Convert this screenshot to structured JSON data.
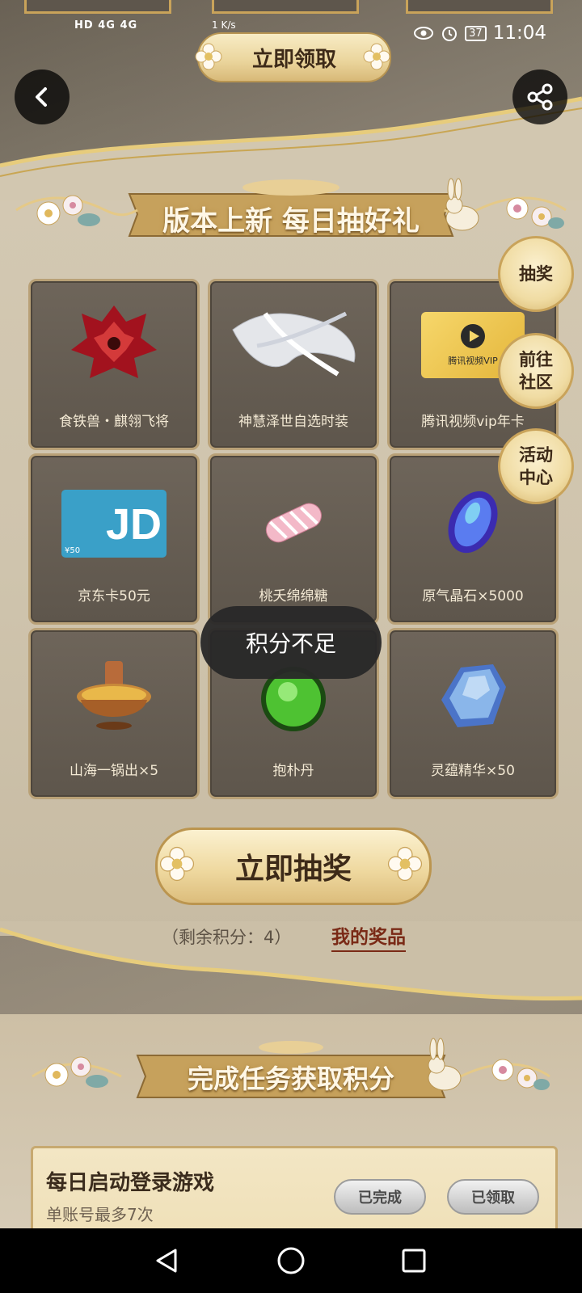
{
  "status_bar": {
    "network": "HD 4G 4G",
    "speed": "1 K/s",
    "battery": "37",
    "time": "11:04"
  },
  "header": {
    "claim_button": "立即领取"
  },
  "draw_section": {
    "banner_title": "版本上新 每日抽好礼",
    "prizes": [
      {
        "name": "食铁兽・麒翎飞将"
      },
      {
        "name": "神慧泽世自选时装"
      },
      {
        "name": "腾讯视频vip年卡",
        "card_text": "腾讯视频VIP"
      },
      {
        "name": "京东卡50元",
        "card_text": "JD",
        "amount": "¥50"
      },
      {
        "name": "桃夭绵绵糖"
      },
      {
        "name": "原气晶石×5000"
      },
      {
        "name": "山海一锅出×5"
      },
      {
        "name": "抱朴丹"
      },
      {
        "name": "灵蕴精华×50"
      }
    ],
    "draw_button": "立即抽奖",
    "remaining_points": "（剩余积分：4）",
    "my_prizes_link": "我的奖品"
  },
  "side_nav": {
    "lottery": "抽奖",
    "community_line1": "前往",
    "community_line2": "社区",
    "activity_line1": "活动",
    "activity_line2": "中心"
  },
  "toast": {
    "message": "积分不足"
  },
  "task_section": {
    "banner_title": "完成任务获取积分",
    "tasks": [
      {
        "title": "每日启动登录游戏",
        "subtitle": "单账号最多7次",
        "status_done": "已完成",
        "status_claimed": "已领取"
      }
    ]
  },
  "colors": {
    "gold": "#d8b978",
    "panel": "#cfc4ad",
    "card": "#5e564c",
    "accent_red": "#7a2a16"
  }
}
